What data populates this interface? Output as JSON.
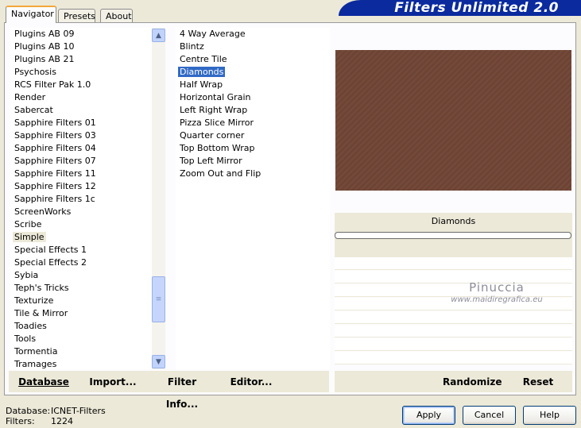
{
  "app": {
    "title": "Filters Unlimited 2.0"
  },
  "tabs": [
    {
      "label": "Navigator",
      "active": true
    },
    {
      "label": "Presets",
      "active": false
    },
    {
      "label": "About",
      "active": false
    }
  ],
  "categories": {
    "items": [
      "Plugins AB 09",
      "Plugins AB 10",
      "Plugins AB 21",
      "Psychosis",
      "RCS Filter Pak 1.0",
      "Render",
      "Sabercat",
      "Sapphire Filters 01",
      "Sapphire Filters 03",
      "Sapphire Filters 04",
      "Sapphire Filters 07",
      "Sapphire Filters 11",
      "Sapphire Filters 12",
      "Sapphire Filters 1c",
      "ScreenWorks",
      "Scribe",
      "Simple",
      "Special Effects 1",
      "Special Effects 2",
      "Sybia",
      "Teph's Tricks",
      "Texturize",
      "Tile & Mirror",
      "Toadies",
      "Tools",
      "Tormentia",
      "Tramages"
    ],
    "current": "Simple"
  },
  "filters": {
    "items": [
      "4 Way Average",
      "Blintz",
      "Centre Tile",
      "Diamonds",
      "Half Wrap",
      "Horizontal Grain",
      "Left Right Wrap",
      "Pizza Slice Mirror",
      "Quarter corner",
      "Top Bottom Wrap",
      "Top Left Mirror",
      "Zoom Out and Flip"
    ],
    "selected": "Diamonds"
  },
  "toolbar": {
    "database": "Database",
    "import": "Import...",
    "filter_info": "Filter Info...",
    "editor": "Editor...",
    "randomize": "Randomize",
    "reset": "Reset"
  },
  "preview": {
    "filter_name": "Diamonds",
    "color": "#724737"
  },
  "watermark": {
    "line1": "Pinuccia",
    "line2": "www.maidiregrafica.eu"
  },
  "status": {
    "database_label": "Database:",
    "database_value": "ICNET-Filters",
    "filters_label": "Filters:",
    "filters_value": "1224"
  },
  "buttons": {
    "apply": "Apply",
    "cancel": "Cancel",
    "help": "Help"
  },
  "colors": {
    "banner": "#0a2a9e",
    "selection": "#316ac5",
    "window_bg": "#ece9d8"
  }
}
